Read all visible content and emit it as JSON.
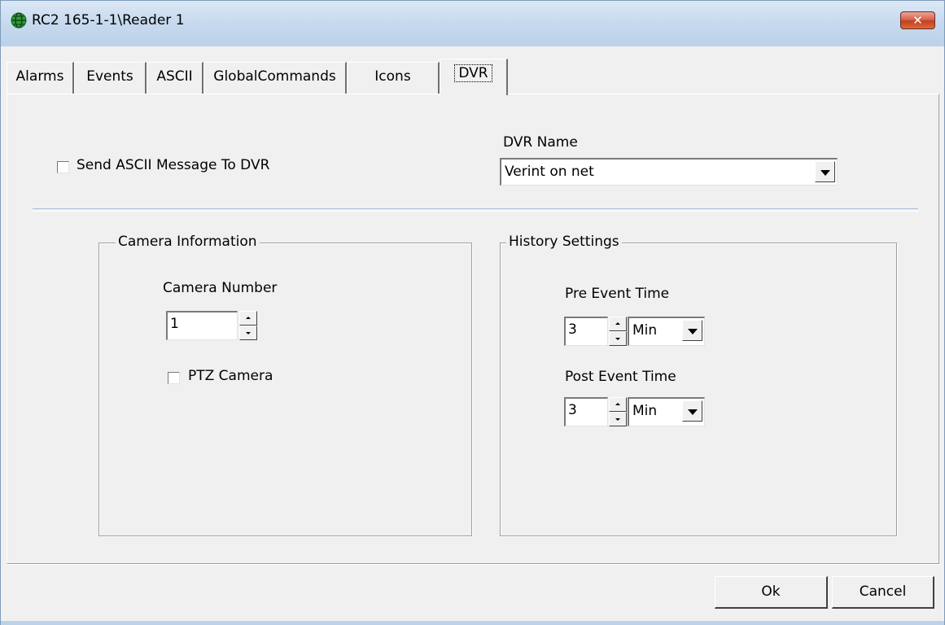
{
  "window": {
    "title": "RC2 165-1-1\\Reader 1",
    "close_label": "✕"
  },
  "tabs": [
    {
      "label": "Alarms"
    },
    {
      "label": "Events"
    },
    {
      "label": "ASCII"
    },
    {
      "label": "GlobalCommands"
    },
    {
      "label": "Icons"
    },
    {
      "label": "DVR"
    }
  ],
  "active_tab": "DVR",
  "dvr": {
    "send_ascii_label": "Send ASCII Message To DVR",
    "send_ascii_checked": false,
    "dvr_name_label": "DVR Name",
    "dvr_name_value": "Verint on net"
  },
  "camera_info": {
    "title": "Camera Information",
    "camera_number_label": "Camera Number",
    "camera_number_value": "1",
    "ptz_label": "PTZ Camera",
    "ptz_checked": false
  },
  "history": {
    "title": "History Settings",
    "pre_label": "Pre Event Time",
    "pre_value": "3",
    "pre_unit": "Min",
    "post_label": "Post Event Time",
    "post_value": "3",
    "post_unit": "Min"
  },
  "buttons": {
    "ok": "Ok",
    "cancel": "Cancel"
  },
  "colors": {
    "titlebar": "#c6d9ee",
    "close": "#c4401f",
    "face": "#f0f0f0"
  }
}
